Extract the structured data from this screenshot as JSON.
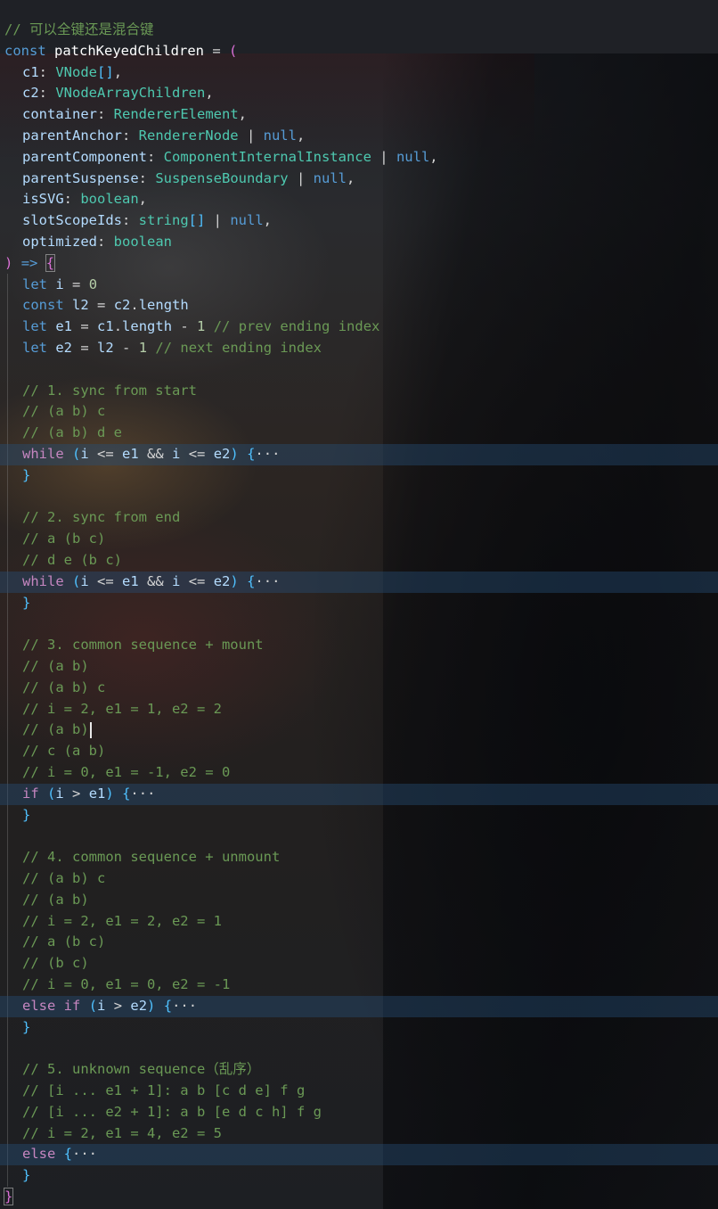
{
  "colors": {
    "comment": "#6a9955",
    "keyword": "#569cd6",
    "type": "#4ec9b0",
    "number": "#b5cea8",
    "bracket_level1": "#da70d6",
    "bracket_level2": "#4fc1ff",
    "fold_highlight": "#264f78"
  },
  "icons": {
    "fold_ellipsis": "ellipsis-icon",
    "text_cursor": "text-cursor-icon"
  },
  "code": {
    "lines": [
      "// 可以全键还是混合键",
      "const patchKeyedChildren = (",
      "  c1: VNode[],",
      "  c2: VNodeArrayChildren,",
      "  container: RendererElement,",
      "  parentAnchor: RendererNode | null,",
      "  parentComponent: ComponentInternalInstance | null,",
      "  parentSuspense: SuspenseBoundary | null,",
      "  isSVG: boolean,",
      "  slotScopeIds: string[] | null,",
      "  optimized: boolean",
      ") => {",
      "  let i = 0",
      "  const l2 = c2.length",
      "  let e1 = c1.length - 1 // prev ending index",
      "  let e2 = l2 - 1 // next ending index",
      "",
      "  // 1. sync from start",
      "  // (a b) c",
      "  // (a b) d e",
      "  while (i <= e1 && i <= e2) {···",
      "  }",
      "",
      "  // 2. sync from end",
      "  // a (b c)",
      "  // d e (b c)",
      "  while (i <= e1 && i <= e2) {···",
      "  }",
      "",
      "  // 3. common sequence + mount",
      "  // (a b)",
      "  // (a b) c",
      "  // i = 2, e1 = 1, e2 = 2",
      "  // (a b)",
      "  // c (a b)",
      "  // i = 0, e1 = -1, e2 = 0",
      "  if (i > e1) {···",
      "  }",
      "",
      "  // 4. common sequence + unmount",
      "  // (a b) c",
      "  // (a b)",
      "  // i = 2, e1 = 2, e2 = 1",
      "  // a (b c)",
      "  // (b c)",
      "  // i = 0, e1 = 0, e2 = -1",
      "  else if (i > e2) {···",
      "  }",
      "",
      "  // 5. unknown sequence（乱序）",
      "  // [i ... e1 + 1]: a b [c d e] f g",
      "  // [i ... e2 + 1]: a b [e d c h] f g",
      "  // i = 2, e1 = 4, e2 = 5",
      "  else {···",
      "  }",
      "}"
    ]
  }
}
